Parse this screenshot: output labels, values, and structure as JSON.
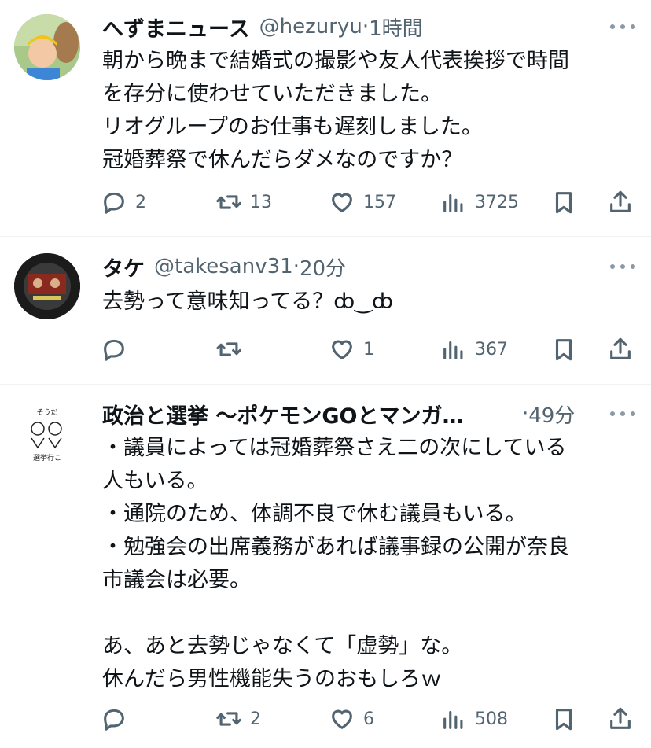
{
  "tweets": [
    {
      "name": "へずまニュース",
      "handle": "@hezuryu",
      "time": "1時間",
      "lines": [
        "朝から晩まで結婚式の撮影や友人代表挨拶で時間",
        "を存分に使わせていただきました。",
        "リオグループのお仕事も遅刻しました。",
        "冠婚葬祭で休んだらダメなのですか？"
      ],
      "replies": "2",
      "retweets": "13",
      "likes": "157",
      "views": "3725"
    },
    {
      "name": "タケ",
      "handle": "@takesanv31",
      "time": "20分",
      "lines": [
        "去勢って意味知ってる？ȸ‿ȸ"
      ],
      "replies": "",
      "retweets": "",
      "likes": "1",
      "views": "367"
    },
    {
      "name": "政治と選挙 〜ポケモンGOとマンガ…",
      "handle": "",
      "time": "49分",
      "avatar_text_top": "そうだ",
      "avatar_text_bottom": "選挙行こ",
      "lines": [
        "・議員によっては冠婚葬祭さえ二の次にしている",
        "人もいる。",
        "・通院のため、体調不良で休む議員もいる。",
        "・勉強会の出席義務があれば議事録の公開が奈良",
        "市議会は必要。",
        "",
        "あ、あと去勢じゃなくて「虚勢」な。",
        "休んだら男性機能失うのおもしろｗ"
      ],
      "replies": "",
      "retweets": "2",
      "likes": "6",
      "views": "508"
    }
  ],
  "separator": "·",
  "icons": {
    "reply": "reply-icon",
    "retweet": "retweet-icon",
    "like": "heart-icon",
    "views": "views-icon",
    "bookmark": "bookmark-icon",
    "share": "share-icon"
  },
  "colors": {
    "text": "#0f1419",
    "secondary": "#536471",
    "divider": "#eff3f4"
  }
}
